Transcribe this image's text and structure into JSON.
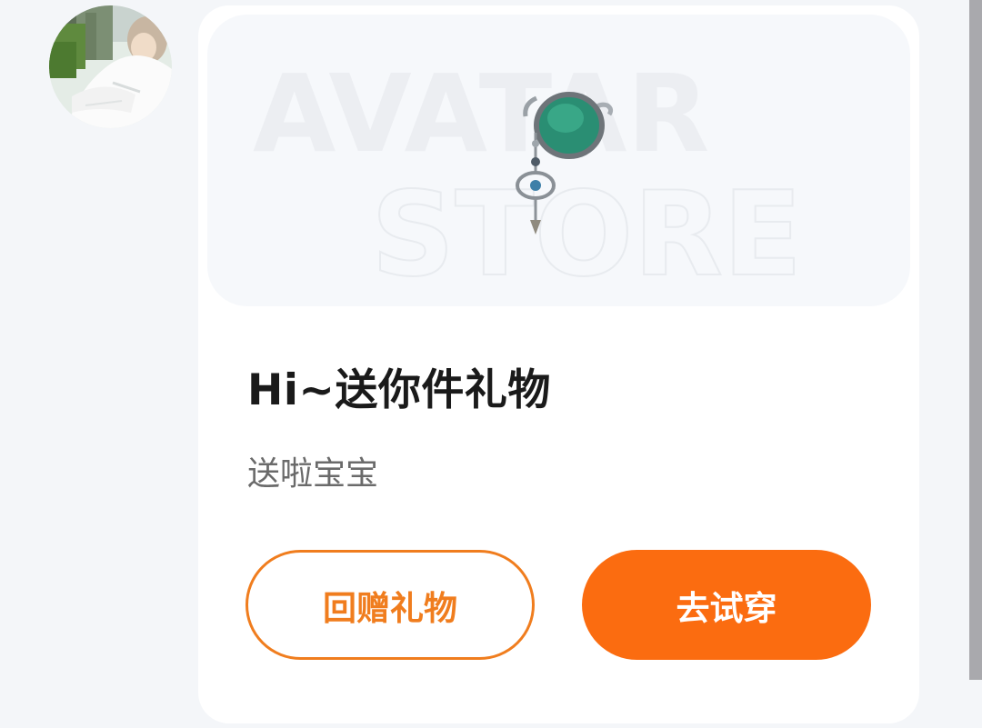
{
  "user": {
    "avatar_alt": "user-avatar"
  },
  "card": {
    "banner": {
      "line1": "AVATAR",
      "line2": "STORE",
      "item_icon": "pendant-ornament-icon"
    },
    "title": "Hi~送你件礼物",
    "message": "送啦宝宝",
    "buttons": {
      "return_gift": "回赠礼物",
      "try_on": "去试穿"
    }
  },
  "colors": {
    "accent": "#fb6c10",
    "accent_outline": "#f07d1e",
    "title_text": "#1a1a1a",
    "secondary_text": "#6a6a6a",
    "page_bg": "#f4f6f9"
  }
}
